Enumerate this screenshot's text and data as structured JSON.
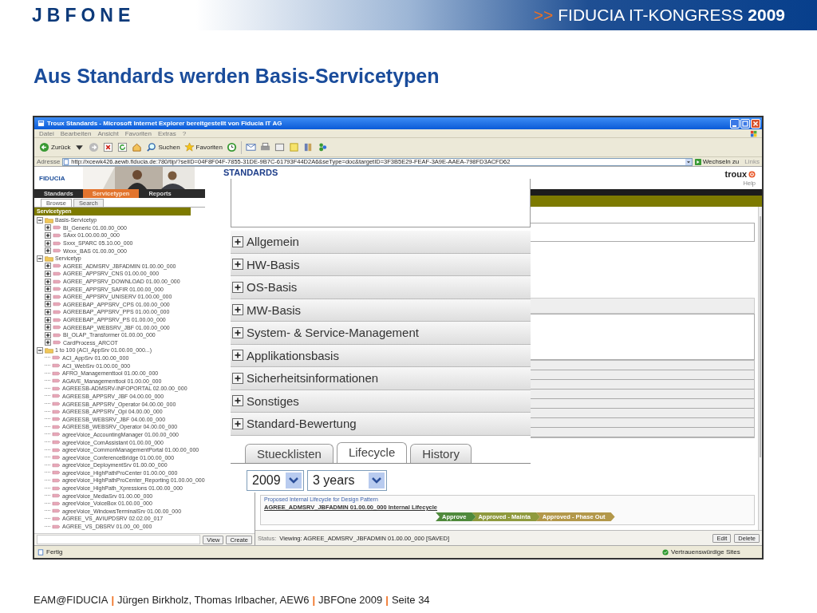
{
  "slide": {
    "logo": "JBFONE",
    "event_prefix": ">>",
    "event": "FIDUCIA IT-KONGRESS **2009**",
    "title": "Aus Standards werden Basis-Servicetypen"
  },
  "browser": {
    "title": "Troux Standards - Microsoft Internet Explorer bereitgestellt von Fiducia IT AG",
    "menu": [
      "Datei",
      "Bearbeiten",
      "Ansicht",
      "Favoriten",
      "Extras",
      "?"
    ],
    "toolbar": {
      "back": "Zurück",
      "search": "Suchen",
      "favorites": "Favoriten"
    },
    "address_label": "Adresse",
    "url": "http://xcewk426.aewb.fiducia.de:780/tip/?selID=04F8F04F-7855-31DE-9B7C-61793F44D2A6&seType=doc&targetID=3F3B5E29-FEAF-3A9E-AAEA-798FD3ACFD62",
    "go": "Wechseln zu",
    "links": "Links",
    "status": "Fertig",
    "zone": "Vertrauenswürdige Sites"
  },
  "app": {
    "brand": "FIDUCIA",
    "heading": "STANDARDS",
    "logo": "troux",
    "help": "Help",
    "nav": [
      {
        "label": "Standards",
        "selected": false
      },
      {
        "label": "Servicetypen",
        "selected": true
      },
      {
        "label": "Reports",
        "selected": false
      }
    ],
    "subtabs": [
      {
        "label": "Browse",
        "selected": true
      },
      {
        "label": "Search",
        "selected": false
      }
    ],
    "tree_title": "Servicetypen",
    "tree": [
      {
        "label": "Basis-Servicetyp",
        "kind": "folder",
        "expanded": true,
        "children": [
          {
            "label": "BI_Generic 01.00.00_000",
            "kind": "item",
            "expanded": false
          },
          {
            "label": "SAxx 01.00.00.00_000",
            "kind": "item",
            "expanded": false
          },
          {
            "label": "Sxxx_SPARC 05.10.00_000",
            "kind": "item",
            "expanded": false
          },
          {
            "label": "Wxxx_BAS 01.00.00_000",
            "kind": "item",
            "expanded": false
          }
        ]
      },
      {
        "label": "Servicetyp",
        "kind": "folder",
        "expanded": true,
        "children": [
          {
            "label": "AGREE_ADMSRV_JBFADMIN 01.00.00_000",
            "kind": "item",
            "expanded": false
          },
          {
            "label": "AGREE_APPSRV_CNS 01.00.00_000",
            "kind": "item",
            "expanded": false
          },
          {
            "label": "AGREE_APPSRV_DOWNLOAD 01.00.00_000",
            "kind": "item",
            "expanded": false
          },
          {
            "label": "AGREE_APPSRV_SAFIR 01.00.00_000",
            "kind": "item",
            "expanded": false
          },
          {
            "label": "AGREE_APPSRV_UNISERV 01.00.00_000",
            "kind": "item",
            "expanded": false
          },
          {
            "label": "AGREEBAP_APPSRV_CPS 01.00.00_000",
            "kind": "item",
            "expanded": false
          },
          {
            "label": "AGREEBAP_APPSRV_PPS 01.00.00_000",
            "kind": "item",
            "expanded": false
          },
          {
            "label": "AGREEBAP_APPSRV_PS 01.00.00_000",
            "kind": "item",
            "expanded": false
          },
          {
            "label": "AGREEBAP_WEBSRV_JBF 01.00.00_000",
            "kind": "item",
            "expanded": false
          },
          {
            "label": "BI_OLAP_Transformer 01.00.00_000",
            "kind": "item",
            "expanded": false
          },
          {
            "label": "CardProcess_ARCOT",
            "kind": "item",
            "expanded": false
          }
        ]
      },
      {
        "label": "1 to 100 (ACI_AppSrv 01.00.00_000...)",
        "kind": "folder",
        "expanded": true,
        "children": [
          {
            "label": "ACI_AppSrv 01.00.00_000",
            "kind": "item"
          },
          {
            "label": "ACI_WebSrv 01.00.00_000",
            "kind": "item"
          },
          {
            "label": "AFRO_Managementtool 01.00.00_000",
            "kind": "item"
          },
          {
            "label": "AGAVE_Managementtool 01.00.00_000",
            "kind": "item"
          },
          {
            "label": "AGREESB-ADMSRV-INFOPORTAL 02.00.00_000",
            "kind": "item"
          },
          {
            "label": "AGREESB_APPSRV_JBF 04.00.00_000",
            "kind": "item"
          },
          {
            "label": "AGREESB_APPSRV_Operator 04.00.00_000",
            "kind": "item"
          },
          {
            "label": "AGREESB_APPSRV_Opl 04.00.00_000",
            "kind": "item"
          },
          {
            "label": "AGREESB_WEBSRV_JBF 04.00.00_000",
            "kind": "item"
          },
          {
            "label": "AGREESB_WEBSRV_Operator 04.00.00_000",
            "kind": "item"
          },
          {
            "label": "agreeVoice_AccountingManager 01.00.00_000",
            "kind": "item"
          },
          {
            "label": "agreeVoice_ComAssistant 01.00.00_000",
            "kind": "item"
          },
          {
            "label": "agreeVoice_CommonManagementPortal 01.00.00_000",
            "kind": "item"
          },
          {
            "label": "agreeVoice_ConferenceBridge 01.00.00_000",
            "kind": "item"
          },
          {
            "label": "agreeVoice_DeploymentSrv 01.00.00_000",
            "kind": "item"
          },
          {
            "label": "agreeVoice_HighPathProCenter 01.00.00_000",
            "kind": "item"
          },
          {
            "label": "agreeVoice_HighPathProCenter_Reporting 01.00.00_000",
            "kind": "item"
          },
          {
            "label": "agreeVoice_HighPath_Xpressions 01.00.00_000",
            "kind": "item"
          },
          {
            "label": "agreeVoice_MediaSrv 01.00.00_000",
            "kind": "item"
          },
          {
            "label": "agreeVoice_VoiceBox 01.00.00_000",
            "kind": "item"
          },
          {
            "label": "agreeVoice_WindowsTerminalSrv 01.00.00_000",
            "kind": "item"
          },
          {
            "label": "AGREE_VS_AVIUPDSRV 02.02.00_017",
            "kind": "item"
          },
          {
            "label": "AGREE_VS_DBSRV 01.00_00_000",
            "kind": "item"
          }
        ]
      }
    ],
    "tree_buttons": [
      "View",
      "Create"
    ],
    "sections": [
      {
        "label": "Allgemein",
        "expanded": false
      },
      {
        "label": "HW-Basis",
        "expanded": false
      },
      {
        "label": "OS-Basis",
        "expanded": false
      },
      {
        "label": "MW-Basis",
        "expanded": false
      },
      {
        "label": "System- & Service-Management",
        "expanded": false
      },
      {
        "label": "Applikationsbasis",
        "expanded": false
      },
      {
        "label": "Sicherheitsinformationen",
        "expanded": false
      },
      {
        "label": "Sonstiges",
        "expanded": false
      },
      {
        "label": "Standard-Bewertung",
        "expanded": false
      }
    ],
    "tabs": [
      {
        "label": "Stuecklisten",
        "selected": false
      },
      {
        "label": "Lifecycle",
        "selected": true
      },
      {
        "label": "History",
        "selected": false
      }
    ],
    "year": "2009",
    "span": "3 years",
    "lifecycle": {
      "legend": "Proposed Internal Lifecycle for Design Pattern",
      "link": "AGREE_ADMSRV_JBFADMIN 01.00.00_000 Internal Lifecycle",
      "phases": [
        {
          "label": "Approve",
          "color": "#4f8a3c"
        },
        {
          "label": "Approved - Mainta",
          "color": "#8f9a3e"
        },
        {
          "label": "Approved - Phase Out",
          "color": "#b3984a"
        }
      ]
    },
    "status_label": "Status:",
    "status": "Viewing: AGREE_ADMSRV_JBFADMIN 01.00.00_000  [SAVED]",
    "actions": [
      "Edit",
      "Delete"
    ]
  },
  "footer": [
    {
      "kind": "text",
      "text": "EAM@FIDUCIA"
    },
    {
      "kind": "sep",
      "text": "|"
    },
    {
      "kind": "text",
      "text": "Jürgen Birkholz, Thomas Irlbacher, AEW6"
    },
    {
      "kind": "sep",
      "text": "|"
    },
    {
      "kind": "text",
      "text": "JBFOne 2009"
    },
    {
      "kind": "sep",
      "text": "|"
    },
    {
      "kind": "text",
      "text": "Seite 34"
    }
  ]
}
